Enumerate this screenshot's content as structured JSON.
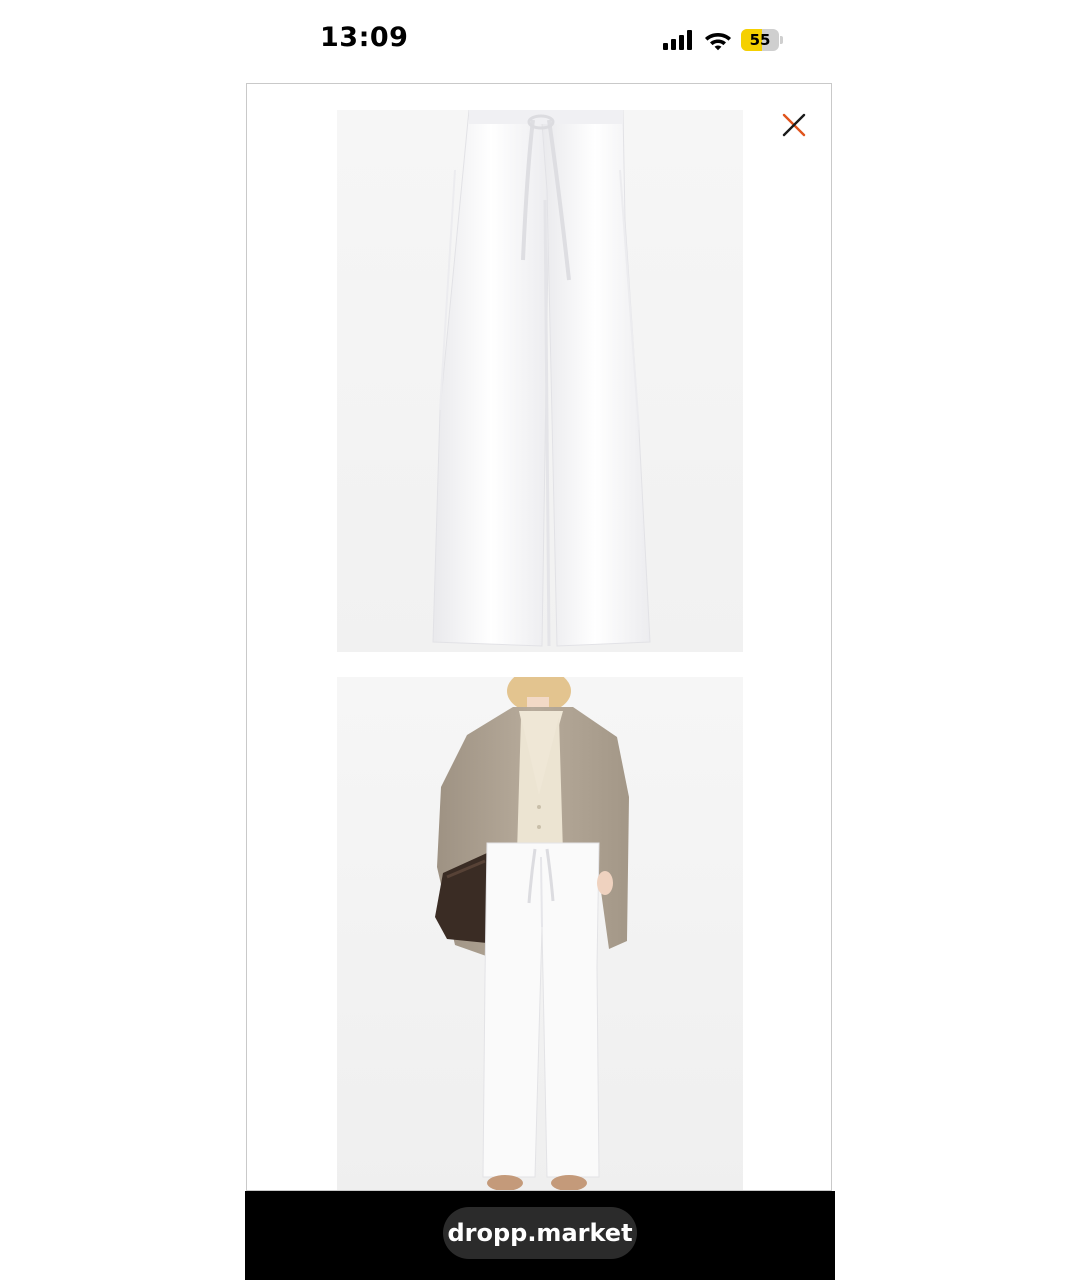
{
  "status_bar": {
    "time": "13:09",
    "battery_level": "55",
    "battery_fraction": 0.55,
    "signal_icon": "cellular-signal-icon",
    "wifi_icon": "wifi-icon"
  },
  "modal": {
    "close_icon": "close-icon",
    "close_color": "#e0541c",
    "images": [
      {
        "subject": "white-wide-leg-trousers-flat"
      },
      {
        "subject": "model-wearing-white-trousers-and-beige-blazer"
      }
    ]
  },
  "browser_bar": {
    "url": "dropp.market"
  },
  "colors": {
    "battery_fill": "#f5d000",
    "bottom_bar": "#000000",
    "pill": "#2b2b2b"
  }
}
